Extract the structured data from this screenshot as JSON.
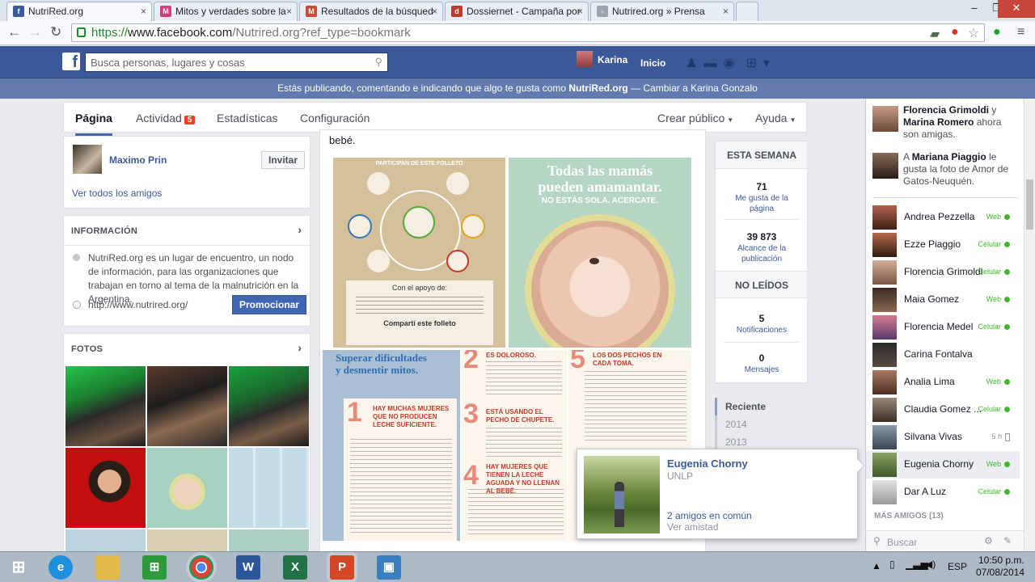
{
  "browser": {
    "tabs": [
      {
        "title": "NutriRed.org",
        "fav": "f",
        "color": "#3b5998",
        "active": true
      },
      {
        "title": "Mitos y verdades sobre la",
        "fav": "M",
        "color": "#d63a7a",
        "active": false
      },
      {
        "title": "Resultados de la búsqued",
        "fav": "M",
        "color": "#d14836",
        "active": false
      },
      {
        "title": "Dossiernet - Campaña por",
        "fav": "d",
        "color": "#c0392b",
        "active": false
      },
      {
        "title": "Nutrired.org » Prensa",
        "fav": "▫",
        "color": "#9aa4ae",
        "active": false
      }
    ],
    "url_https": "https://",
    "url_domain": "www.facebook.com",
    "url_rest": "/Nutrired.org?ref_type=bookmark"
  },
  "fb": {
    "logo": "f",
    "search_placeholder": "Busca personas, lugares y cosas",
    "user": "Karina",
    "home": "Inicio"
  },
  "banner": {
    "prefix": "Estás publicando, comentando e indicando que algo te gusta como ",
    "page": "NutriRed.org",
    "suffix": " — Cambiar a Karina Gonzalo"
  },
  "pagenav": {
    "items": [
      "Página",
      "Actividad",
      "Estadísticas",
      "Configuración"
    ],
    "activity_badge": "5",
    "right": [
      "Crear público",
      "Ayuda"
    ]
  },
  "invite": {
    "name": "Maximo Prin",
    "button": "Invitar",
    "see_all": "Ver todos los amigos"
  },
  "info": {
    "title": "INFORMACIÓN",
    "description": "NutriRed.org es un lugar de encuentro, un nodo de información, para las organizaciones que trabajan en torno al tema de la malnutrición en la Argentina.",
    "url": "http://www.nutrired.org/",
    "promote": "Promocionar"
  },
  "photos": {
    "title": "FOTOS"
  },
  "post": {
    "text_fragment": "bebé.",
    "flyer": {
      "participants": "PARTICIPAN DE ESTE FOLLETO",
      "headline1": "Todas las mamás",
      "headline2": "pueden amamantar.",
      "tagline": "NO ESTÁS SOLA. ACERCATE.",
      "support": "Con el apoyo de:",
      "share": "Compartí este folleto",
      "overcome1": "Superar dificultades",
      "overcome2": "y desmentir mitos.",
      "myth1": "HAY MUCHAS MUJERES QUE NO PRODUCEN LECHE SUFICIENTE.",
      "myth2": "ESTÁ USANDO EL PECHO DE CHUPETE.",
      "myth4": "HAY MUJERES QUE TIENEN LA LECHE AGUADA Y NO LLENAN AL BEBÉ.",
      "top2": "ES DOLOROSO.",
      "top5": "LOS DOS PECHOS EN CADA TOMA."
    }
  },
  "stats": {
    "week_title": "ESTA SEMANA",
    "likes": "71",
    "likes_label": "Me gusta de la página",
    "reach": "39 873",
    "reach_label": "Alcance de la publicación",
    "unread_title": "NO LEÍDOS",
    "notif": "5",
    "notif_label": "Notificaciones",
    "msgs": "0",
    "msgs_label": "Mensajes"
  },
  "years": [
    "Reciente",
    "2014",
    "2013"
  ],
  "hovercard": {
    "name": "Eugenia Chorny",
    "school": "UNLP",
    "mutual": "2 amigos en común",
    "action": "Ver amistad"
  },
  "ticker": [
    {
      "a": "Florencia Grimoldi",
      "mid": " y ",
      "b": "Marina Romero",
      "rest": " ahora son amigas."
    },
    {
      "a": "A ",
      "b": "Mariana Piaggio",
      "rest": " le gusta la foto de Amor de Gatos-Neuquén."
    }
  ],
  "friends": [
    {
      "name": "Andrea Pezzella",
      "status": "Web",
      "idle": false
    },
    {
      "name": "Ezze Piaggio",
      "status": "Celular",
      "idle": false
    },
    {
      "name": "Florencia Grimoldi",
      "status": "Celular",
      "idle": false
    },
    {
      "name": "Maia Gomez",
      "status": "Web",
      "idle": false
    },
    {
      "name": "Florencia Medel",
      "status": "Celular",
      "idle": false
    },
    {
      "name": "Carina Fontalva",
      "status": "",
      "idle": false
    },
    {
      "name": "Analia Lima",
      "status": "Web",
      "idle": false
    },
    {
      "name": "Claudia Gomez ...",
      "status": "Celular",
      "idle": false
    },
    {
      "name": "Silvana Vivas",
      "status": "5 h",
      "idle": true
    },
    {
      "name": "Eugenia Chorny",
      "status": "Web",
      "idle": false
    },
    {
      "name": "Dar A Luz",
      "status": "Celular",
      "idle": false
    }
  ],
  "more_friends": "MÁS AMIGOS (13)",
  "chat_search": "Buscar",
  "taskbar": {
    "lang": "ESP",
    "time": "10:50 p.m.",
    "date": "07/08/2014"
  }
}
